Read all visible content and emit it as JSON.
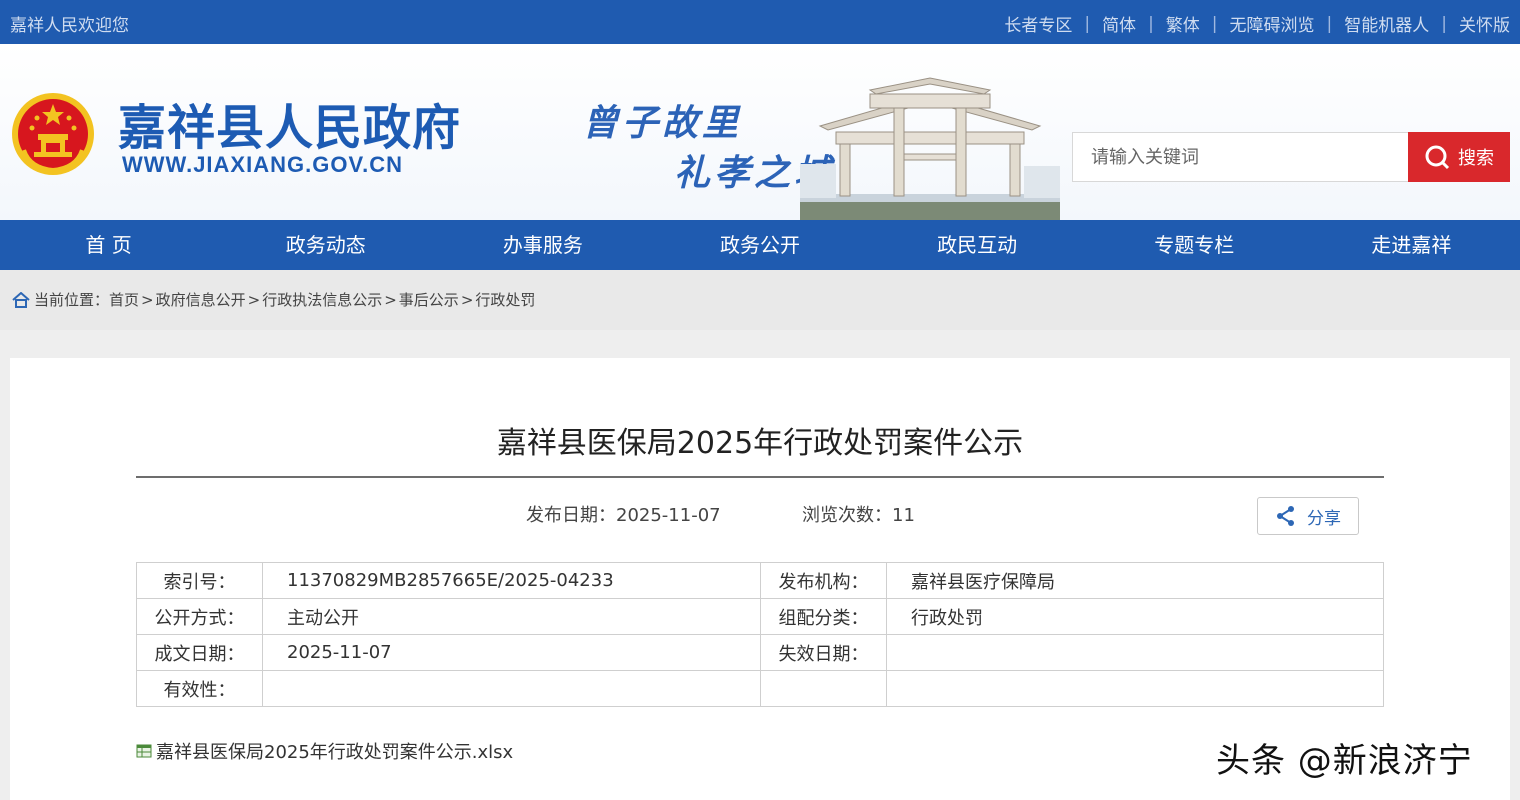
{
  "topbar": {
    "welcome": "嘉祥人民欢迎您",
    "links": [
      "长者专区",
      "简体",
      "繁体",
      "无障碍浏览",
      "智能机器人",
      "关怀版"
    ]
  },
  "header": {
    "site_name": "嘉祥县人民政府",
    "site_url": "WWW.JIAXIANG.GOV.CN",
    "slogan_line1": "曾子故里",
    "slogan_line2": "礼孝之城"
  },
  "search": {
    "placeholder": "请输入关键词",
    "button_label": "搜索",
    "icon": "search-icon"
  },
  "nav": {
    "items": [
      "首 页",
      "政务动态",
      "办事服务",
      "政务公开",
      "政民互动",
      "专题专栏",
      "走进嘉祥"
    ]
  },
  "breadcrumb": {
    "prefix": "当前位置：",
    "items": [
      "首页",
      "政府信息公开",
      "行政执法信息公示",
      "事后公示",
      "行政处罚"
    ],
    "separator": ">"
  },
  "article": {
    "title": "嘉祥县医保局2025年行政处罚案件公示",
    "publish_date_label": "发布日期：2025-11-07",
    "views_label": "浏览次数：11",
    "share_label": "分享"
  },
  "info_table": {
    "rows": [
      {
        "k1": "索引号：",
        "v1": "11370829MB2857665E/2025-04233",
        "k2": "发布机构：",
        "v2": "嘉祥县医疗保障局"
      },
      {
        "k1": "公开方式：",
        "v1": "主动公开",
        "k2": "组配分类：",
        "v2": "行政处罚"
      },
      {
        "k1": "成文日期：",
        "v1": "2025-11-07",
        "k2": "失效日期：",
        "v2": ""
      },
      {
        "k1": "有效性：",
        "v1": "",
        "k2": "",
        "v2": ""
      }
    ]
  },
  "attachment": {
    "filename": "嘉祥县医保局2025年行政处罚案件公示.xlsx",
    "icon": "excel-file-icon"
  },
  "watermark": {
    "text": "头条 @新浪济宁"
  },
  "colors": {
    "brand_blue": "#1f5bb0",
    "search_red": "#d9282c",
    "emblem_red": "#d7161e",
    "emblem_gold": "#f3c321"
  }
}
